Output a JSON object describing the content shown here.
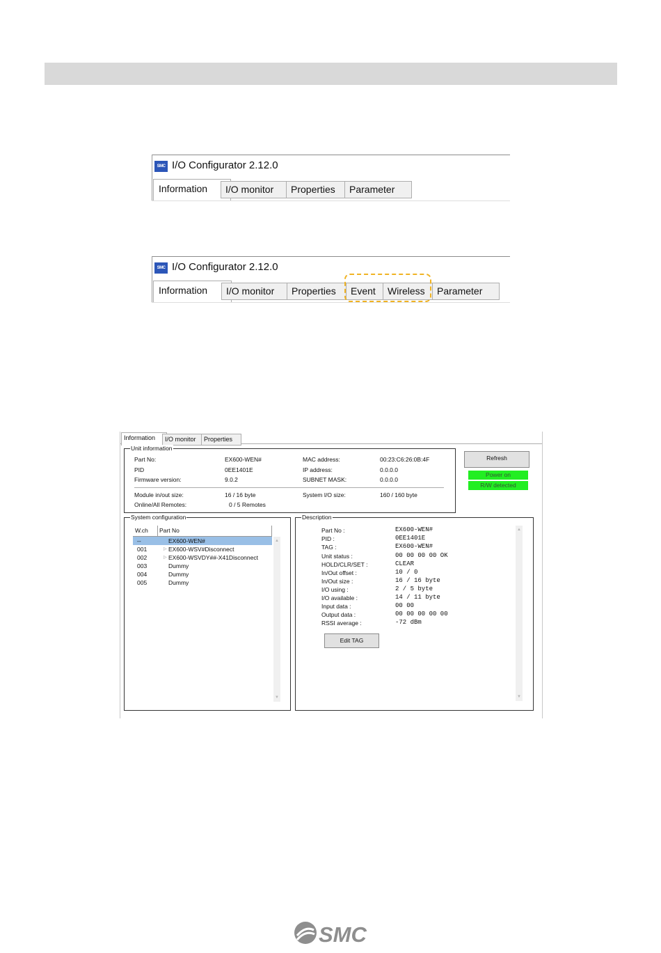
{
  "app_v1": {
    "title": "I/O Configurator 2.12.0",
    "logo_text": "SMC",
    "tabs": [
      "Information",
      "I/O monitor",
      "Properties",
      "Parameter"
    ]
  },
  "app_v2": {
    "title": "I/O Configurator 2.12.0",
    "logo_text": "SMC",
    "tabs": [
      "Information",
      "I/O monitor",
      "Properties",
      "Event",
      "Wireless",
      "Parameter"
    ]
  },
  "panel": {
    "tabs": [
      "Information",
      "I/O monitor",
      "Properties"
    ],
    "unit_info": {
      "label": "Unit information",
      "rows": [
        {
          "k1": "Part No:",
          "v1": "EX600-WEN#",
          "k2": "MAC address:",
          "v2": "00:23:C6:26:0B:4F"
        },
        {
          "k1": "PID",
          "v1": "0EE1401E",
          "k2": "IP address:",
          "v2": "0.0.0.0"
        },
        {
          "k1": "Firmware version:",
          "v1": "9.0.2",
          "k2": "SUBNET MASK:",
          "v2": "0.0.0.0"
        },
        {
          "k1": "Module in/out size:",
          "v1": "16 / 16 byte",
          "k2": "System I/O size:",
          "v2": "160 / 160 byte"
        },
        {
          "k1": "Online/All Remotes:",
          "v1": "0 / 5 Remotes",
          "k2": "",
          "v2": ""
        }
      ]
    },
    "refresh_label": "Refresh",
    "status_power": "Power on",
    "status_rw": "R/W detected",
    "sysconf": {
      "label": "System configuration",
      "col_wch": "W.ch",
      "col_part": "Part No",
      "rows": [
        {
          "wch": "--",
          "part": "EX600-WEN#"
        },
        {
          "wch": "001",
          "part": "EX600-WSV#Disconnect"
        },
        {
          "wch": "002",
          "part": "EX600-WSVDY##-X41Disconnect"
        },
        {
          "wch": "003",
          "part": "Dummy"
        },
        {
          "wch": "004",
          "part": "Dummy"
        },
        {
          "wch": "005",
          "part": "Dummy"
        }
      ]
    },
    "description": {
      "label": "Description",
      "rows": [
        {
          "k": "Part No :",
          "v": "EX600-WEN#"
        },
        {
          "k": "PID :",
          "v": "0EE1401E"
        },
        {
          "k": "TAG :",
          "v": "EX600-WEN#"
        },
        {
          "k": "Unit status :",
          "v": "00 00 00 00 OK"
        },
        {
          "k": "HOLD/CLR/SET :",
          "v": "CLEAR"
        },
        {
          "k": "In/Out offset :",
          "v": "10 / 0"
        },
        {
          "k": "In/Out size :",
          "v": "16 / 16 byte"
        },
        {
          "k": "I/O using :",
          "v": "2 / 5 byte"
        },
        {
          "k": "I/O available :",
          "v": "14 / 11 byte"
        },
        {
          "k": "Input data :",
          "v": "00 00"
        },
        {
          "k": "Output data :",
          "v": "00 00 00 00 00"
        },
        {
          "k": "RSSI average :",
          "v": "-72 dBm"
        }
      ],
      "edit_tag_label": "Edit TAG"
    }
  },
  "footer": {
    "logo_text": "SMC"
  }
}
